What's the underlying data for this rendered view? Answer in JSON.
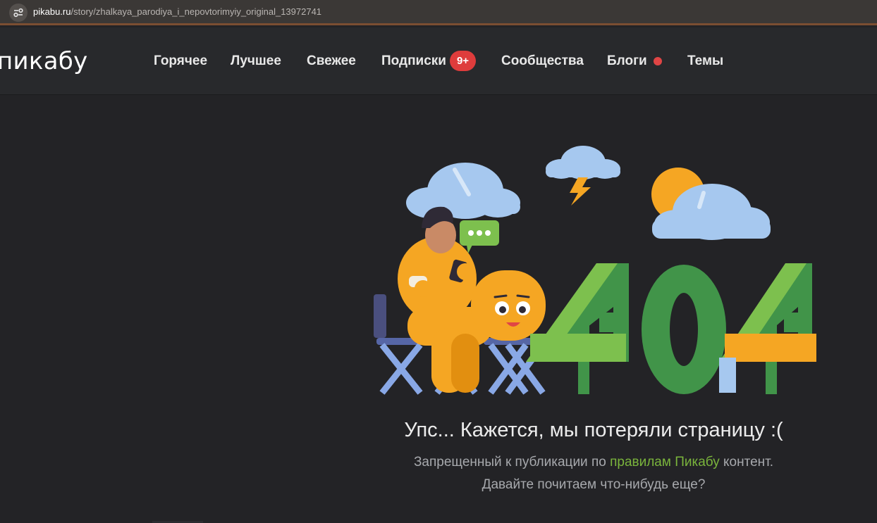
{
  "browser": {
    "url_host": "pikabu.ru",
    "url_path": "/story/zhalkaya_parodiya_i_nepovtorimyiy_original_13972741"
  },
  "header": {
    "logo": "пикабу",
    "nav": [
      {
        "label": "Горячее"
      },
      {
        "label": "Лучшее"
      },
      {
        "label": "Свежее"
      },
      {
        "label": "Подписки",
        "badge": "9+"
      },
      {
        "label": "Сообщества"
      },
      {
        "label": "Блоги"
      },
      {
        "label": "Темы"
      }
    ]
  },
  "error": {
    "title": "Упс... Кажется, мы потеряли страницу :(",
    "line1_before": "Запрещенный к публикации по ",
    "line1_link": "правилам Пикабу",
    "line1_after": " контент.",
    "line2": "Давайте почитаем что-нибудь еще?"
  },
  "colors": {
    "accent_green": "#7ab43c",
    "badge_red": "#de3c3c",
    "background": "#232326",
    "header_bg": "#28292c"
  },
  "icons": {
    "site_info": "tune-icon",
    "blogs_indicator": "red-dot-icon"
  }
}
